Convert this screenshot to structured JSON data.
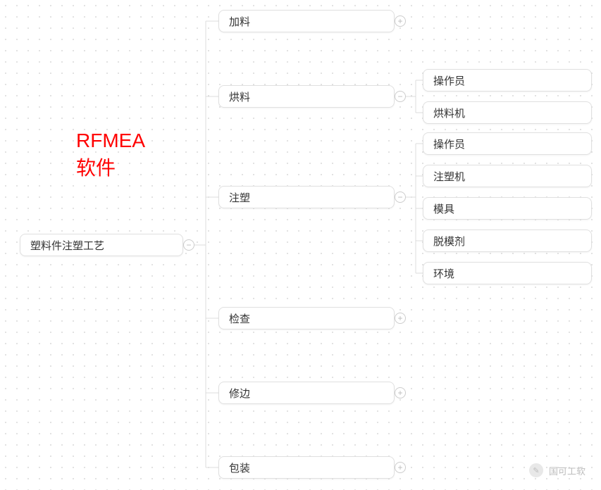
{
  "title": "RFMEA\n软件",
  "root": {
    "label": "塑料件注塑工艺",
    "toggle": "−"
  },
  "level2": [
    {
      "label": "加料",
      "toggle": "+"
    },
    {
      "label": "烘料",
      "toggle": "−"
    },
    {
      "label": "注塑",
      "toggle": "−"
    },
    {
      "label": "检查",
      "toggle": "+"
    },
    {
      "label": "修边",
      "toggle": "+"
    },
    {
      "label": "包装",
      "toggle": "+"
    }
  ],
  "level3_group1": [
    {
      "label": "操作员"
    },
    {
      "label": "烘料机"
    }
  ],
  "level3_group2": [
    {
      "label": "操作员"
    },
    {
      "label": "注塑机"
    },
    {
      "label": "模具"
    },
    {
      "label": "脱模剂"
    },
    {
      "label": "环境"
    }
  ],
  "footer": "国可工软"
}
